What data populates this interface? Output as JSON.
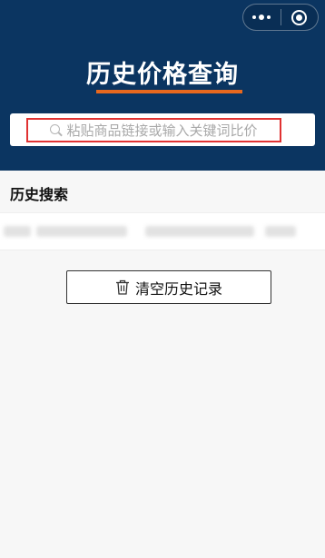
{
  "header": {
    "title": "历史价格查询",
    "background_color": "#0b3561",
    "underline_color": "#e8681e"
  },
  "capsule": {
    "menu_icon": "more-dots-icon",
    "close_icon": "target-circle-icon"
  },
  "search": {
    "placeholder": "粘贴商品链接或输入关键词比价",
    "icon": "search-icon",
    "highlight_color": "#e03232"
  },
  "history": {
    "section_title": "历史搜索",
    "clear_label": "清空历史记录",
    "clear_icon": "trash-icon"
  }
}
